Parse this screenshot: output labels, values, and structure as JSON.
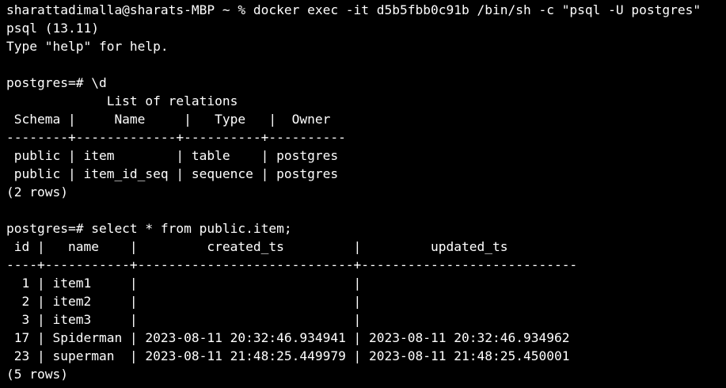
{
  "terminal": {
    "background": "#000000",
    "foreground": "#ffffff",
    "lines": [
      "sharattadimalla@sharats-MBP ~ % docker exec -it d5b5fbb0c91b /bin/sh -c \"psql -U postgres\"",
      "psql (13.11)",
      "Type \"help\" for help.",
      "",
      "postgres=# \\d",
      "             List of relations",
      " Schema |     Name     |   Type   |  Owner",
      "--------+-------------+----------+----------",
      " public | item        | table    | postgres",
      " public | item_id_seq | sequence | postgres",
      "(2 rows)",
      "",
      "postgres=# select * from public.item;",
      " id |   name    |         created_ts         |         updated_ts",
      "----+-----------+----------------------------+----------------------------",
      "  1 | item1     |                            |",
      "  2 | item2     |                            |",
      "  3 | item3     |                            |",
      " 17 | Spiderman | 2023-08-11 20:32:46.934941 | 2023-08-11 20:32:46.934962",
      " 23 | superman  | 2023-08-11 21:48:25.449979 | 2023-08-11 21:48:25.450001",
      "(5 rows)"
    ]
  }
}
